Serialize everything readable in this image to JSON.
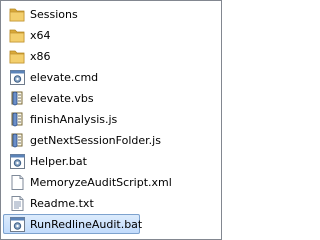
{
  "files": [
    {
      "name": "Sessions",
      "icon": "folder-icon",
      "selected": false
    },
    {
      "name": "x64",
      "icon": "folder-icon",
      "selected": false
    },
    {
      "name": "x86",
      "icon": "folder-icon",
      "selected": false
    },
    {
      "name": "elevate.cmd",
      "icon": "cmd-gear-icon",
      "selected": false
    },
    {
      "name": "elevate.vbs",
      "icon": "script-icon",
      "selected": false
    },
    {
      "name": "finishAnalysis.js",
      "icon": "script-icon",
      "selected": false
    },
    {
      "name": "getNextSessionFolder.js",
      "icon": "script-icon",
      "selected": false
    },
    {
      "name": "Helper.bat",
      "icon": "batch-gear-icon",
      "selected": false
    },
    {
      "name": "MemoryzeAuditScript.xml",
      "icon": "document-icon",
      "selected": false
    },
    {
      "name": "Readme.txt",
      "icon": "text-file-icon",
      "selected": false
    },
    {
      "name": "RunRedlineAudit.bat",
      "icon": "batch-gear-icon",
      "selected": true
    }
  ],
  "colors": {
    "folder": "#e8c25a",
    "selection": "#cce0fb",
    "selection_border": "#7da2ce",
    "frame_border": "#828790"
  }
}
